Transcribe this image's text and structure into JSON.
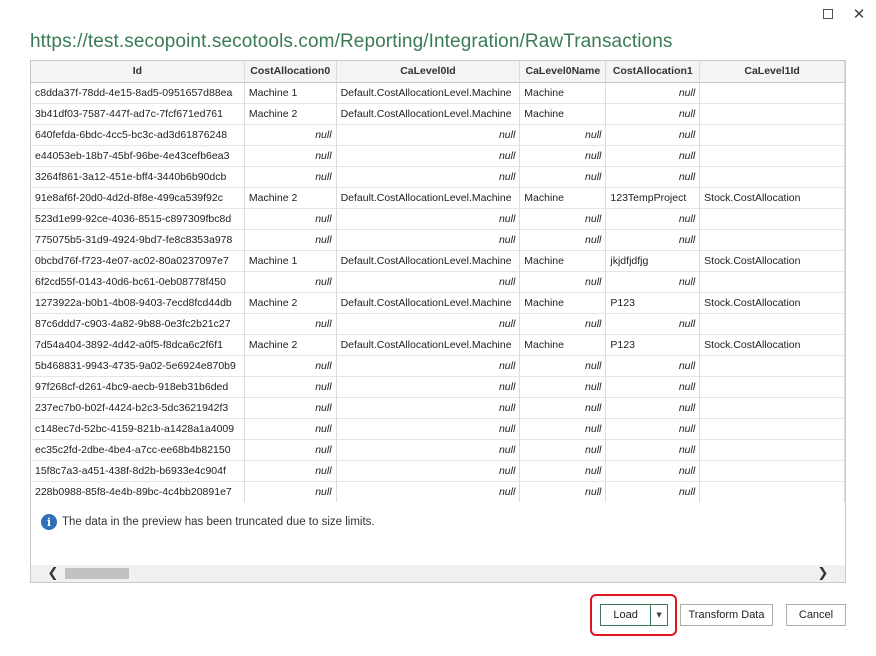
{
  "window": {
    "maximize_icon": "maximize-icon",
    "close_icon": "close-icon",
    "close_glyph": "✕"
  },
  "title": "https://test.secopoint.secotools.com/Reporting/Integration/RawTransactions",
  "table": {
    "columns": [
      "Id",
      "CostAllocation0",
      "CaLevel0Id",
      "CaLevel0Name",
      "CostAllocation1",
      "CaLevel1Id"
    ],
    "rows": [
      [
        "c8dda37f-78dd-4e15-8ad5-0951657d88ea",
        "Machine 1",
        "Default.CostAllocationLevel.Machine",
        "Machine",
        "null",
        ""
      ],
      [
        "3b41df03-7587-447f-ad7c-7fcf671ed761",
        "Machine 2",
        "Default.CostAllocationLevel.Machine",
        "Machine",
        "null",
        ""
      ],
      [
        "640fefda-6bdc-4cc5-bc3c-ad3d61876248",
        "null",
        "null",
        "null",
        "null",
        ""
      ],
      [
        "e44053eb-18b7-45bf-96be-4e43cefb6ea3",
        "null",
        "null",
        "null",
        "null",
        ""
      ],
      [
        "3264f861-3a12-451e-bff4-3440b6b90dcb",
        "null",
        "null",
        "null",
        "null",
        ""
      ],
      [
        "91e8af6f-20d0-4d2d-8f8e-499ca539f92c",
        "Machine 2",
        "Default.CostAllocationLevel.Machine",
        "Machine",
        "123TempProject",
        "Stock.CostAllocation"
      ],
      [
        "523d1e99-92ce-4036-8515-c897309fbc8d",
        "null",
        "null",
        "null",
        "null",
        ""
      ],
      [
        "775075b5-31d9-4924-9bd7-fe8c8353a978",
        "null",
        "null",
        "null",
        "null",
        ""
      ],
      [
        "0bcbd76f-f723-4e07-ac02-80a0237097e7",
        "Machine 1",
        "Default.CostAllocationLevel.Machine",
        "Machine",
        "jkjdfjdfjg",
        "Stock.CostAllocation"
      ],
      [
        "6f2cd55f-0143-40d6-bc61-0eb08778f450",
        "null",
        "null",
        "null",
        "null",
        ""
      ],
      [
        "1273922a-b0b1-4b08-9403-7ecd8fcd44db",
        "Machine 2",
        "Default.CostAllocationLevel.Machine",
        "Machine",
        "P123",
        "Stock.CostAllocation"
      ],
      [
        "87c6ddd7-c903-4a82-9b88-0e3fc2b21c27",
        "null",
        "null",
        "null",
        "null",
        ""
      ],
      [
        "7d54a404-3892-4d42-a0f5-f8dca6c2f6f1",
        "Machine 2",
        "Default.CostAllocationLevel.Machine",
        "Machine",
        "P123",
        "Stock.CostAllocation"
      ],
      [
        "5b468831-9943-4735-9a02-5e6924e870b9",
        "null",
        "null",
        "null",
        "null",
        ""
      ],
      [
        "97f268cf-d261-4bc9-aecb-918eb31b6ded",
        "null",
        "null",
        "null",
        "null",
        ""
      ],
      [
        "237ec7b0-b02f-4424-b2c3-5dc3621942f3",
        "null",
        "null",
        "null",
        "null",
        ""
      ],
      [
        "c148ec7d-52bc-4159-821b-a1428a1a4009",
        "null",
        "null",
        "null",
        "null",
        ""
      ],
      [
        "ec35c2fd-2dbe-4be4-a7cc-ee68b4b82150",
        "null",
        "null",
        "null",
        "null",
        ""
      ],
      [
        "15f8c7a3-a451-438f-8d2b-b6933e4c904f",
        "null",
        "null",
        "null",
        "null",
        ""
      ],
      [
        "228b0988-85f8-4e4b-89bc-4c4bb20891e7",
        "null",
        "null",
        "null",
        "null",
        ""
      ]
    ]
  },
  "info": {
    "icon": "info-icon",
    "message": "The data in the preview has been truncated due to size limits."
  },
  "scrollbar": {
    "left_arrow": "❮",
    "right_arrow": "❯"
  },
  "buttons": {
    "load_label": "Load",
    "load_dropdown_glyph": "▼",
    "transform_label": "Transform Data",
    "cancel_label": "Cancel"
  },
  "colors": {
    "accent_green": "#3a7b55",
    "highlight_red": "#e0141e",
    "info_blue": "#2f6fb7"
  }
}
